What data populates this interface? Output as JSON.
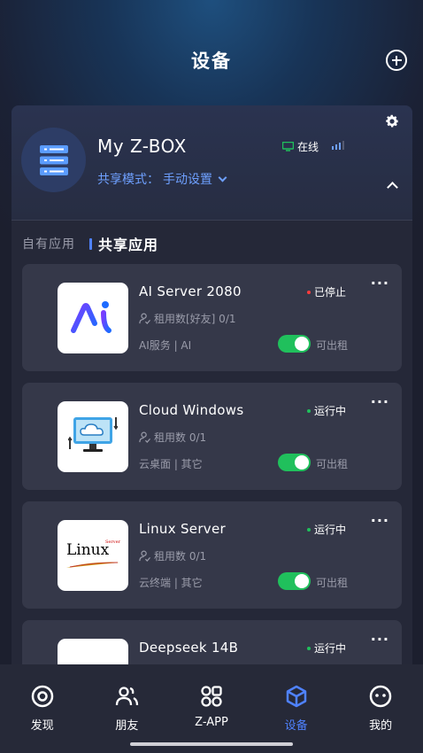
{
  "header": {
    "title": "设备"
  },
  "device": {
    "name": "My Z-BOX",
    "status": "在线",
    "share_mode_label": "共享模式：",
    "share_mode_value": "手动设置"
  },
  "tabs": {
    "own": "自有应用",
    "shared": "共享应用"
  },
  "apps": [
    {
      "title": "AI Server 2080",
      "status": "已停止",
      "status_color": "#ff3b3b",
      "rent": "租用数[好友] 0/1",
      "category": "AI服务 | AI",
      "rentable": "可出租",
      "logo": "ai-logo",
      "logo_text": "Ai"
    },
    {
      "title": "Cloud Windows",
      "status": "运行中",
      "status_color": "#20c05c",
      "rent": "租用数 0/1",
      "category": "云桌面 | 其它",
      "rentable": "可出租",
      "logo": "cloud-monitor-logo"
    },
    {
      "title": "Linux Server",
      "status": "运行中",
      "status_color": "#20c05c",
      "rent": "租用数 0/1",
      "category": "云终端 | 其它",
      "rentable": "可出租",
      "logo": "linux-logo",
      "logo_text": "Linux",
      "logo_sup": "Server"
    },
    {
      "title": "Deepseek 14B",
      "status": "运行中",
      "status_color": "#20c05c",
      "logo": "blank-logo"
    }
  ],
  "more": "···",
  "nav": [
    {
      "label": "发现",
      "icon": "target-icon"
    },
    {
      "label": "朋友",
      "icon": "friends-icon"
    },
    {
      "label": "Z-APP",
      "icon": "apps-grid-icon"
    },
    {
      "label": "设备",
      "icon": "box-icon",
      "active": true
    },
    {
      "label": "我的",
      "icon": "smile-icon"
    }
  ],
  "colors": {
    "accent": "#4f82ff",
    "running": "#20c05c",
    "stopped": "#ff3b3b",
    "online": "#20c05c"
  }
}
